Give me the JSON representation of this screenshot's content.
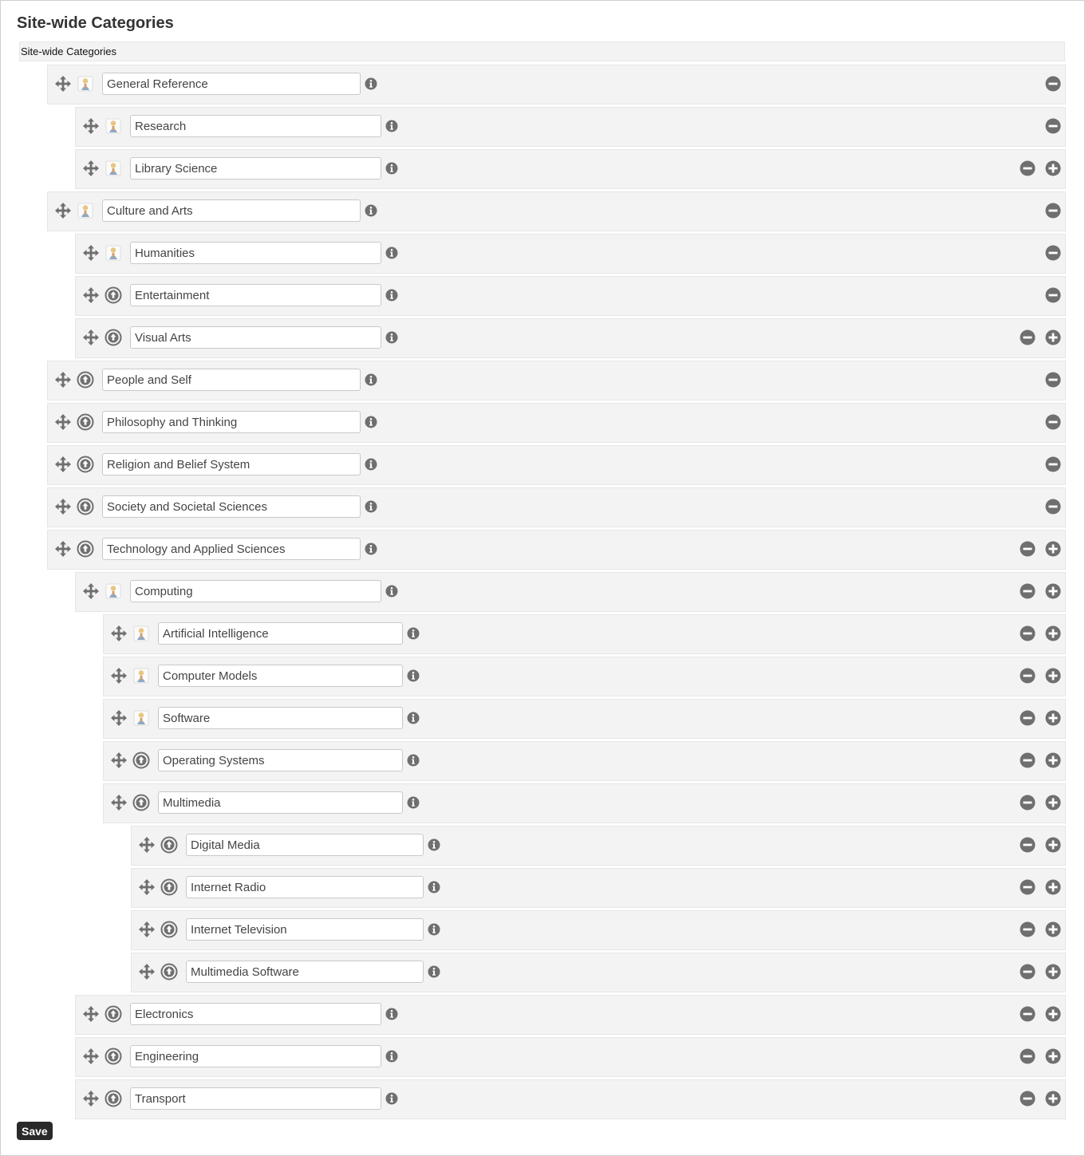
{
  "page": {
    "title": "Site-wide Categories",
    "root_label": "Site-wide Categories",
    "save_label": "Save"
  },
  "icons": {
    "drag": "move-arrows-icon",
    "upload": "upload-circle-icon",
    "info": "info-icon",
    "remove": "minus-circle-icon",
    "add": "plus-circle-icon"
  },
  "colors": {
    "icon_gray": "#6f6f6f",
    "row_bg": "#f3f3f3",
    "row_border": "#e6e6e6",
    "save_bg": "#2a2a2a"
  },
  "categories": [
    {
      "name": "General Reference",
      "level": 1,
      "icon": "image",
      "add": false
    },
    {
      "name": "Research",
      "level": 2,
      "icon": "image",
      "add": false
    },
    {
      "name": "Library Science",
      "level": 2,
      "icon": "image",
      "add": true
    },
    {
      "name": "Culture and Arts",
      "level": 1,
      "icon": "image",
      "add": false
    },
    {
      "name": "Humanities",
      "level": 2,
      "icon": "image",
      "add": false
    },
    {
      "name": "Entertainment",
      "level": 2,
      "icon": "upload",
      "add": false
    },
    {
      "name": "Visual Arts",
      "level": 2,
      "icon": "upload",
      "add": true
    },
    {
      "name": "People and Self",
      "level": 1,
      "icon": "upload",
      "add": false
    },
    {
      "name": "Philosophy and Thinking",
      "level": 1,
      "icon": "upload",
      "add": false
    },
    {
      "name": "Religion and Belief System",
      "level": 1,
      "icon": "upload",
      "add": false
    },
    {
      "name": "Society and Societal Sciences",
      "level": 1,
      "icon": "upload",
      "add": false
    },
    {
      "name": "Technology and Applied Sciences",
      "level": 1,
      "icon": "upload",
      "add": true
    },
    {
      "name": "Computing",
      "level": 2,
      "icon": "image",
      "add": true
    },
    {
      "name": "Artificial Intelligence",
      "level": 3,
      "icon": "image",
      "add": true
    },
    {
      "name": "Computer Models",
      "level": 3,
      "icon": "image",
      "add": true
    },
    {
      "name": "Software",
      "level": 3,
      "icon": "image",
      "add": true
    },
    {
      "name": "Operating Systems",
      "level": 3,
      "icon": "upload",
      "add": true
    },
    {
      "name": "Multimedia",
      "level": 3,
      "icon": "upload",
      "add": true
    },
    {
      "name": "Digital Media",
      "level": 4,
      "icon": "upload",
      "add": true
    },
    {
      "name": "Internet Radio",
      "level": 4,
      "icon": "upload",
      "add": true
    },
    {
      "name": "Internet Television",
      "level": 4,
      "icon": "upload",
      "add": true
    },
    {
      "name": "Multimedia Software",
      "level": 4,
      "icon": "upload",
      "add": true
    },
    {
      "name": "Electronics",
      "level": 2,
      "icon": "upload",
      "add": true
    },
    {
      "name": "Engineering",
      "level": 2,
      "icon": "upload",
      "add": true
    },
    {
      "name": "Transport",
      "level": 2,
      "icon": "upload",
      "add": true
    }
  ]
}
